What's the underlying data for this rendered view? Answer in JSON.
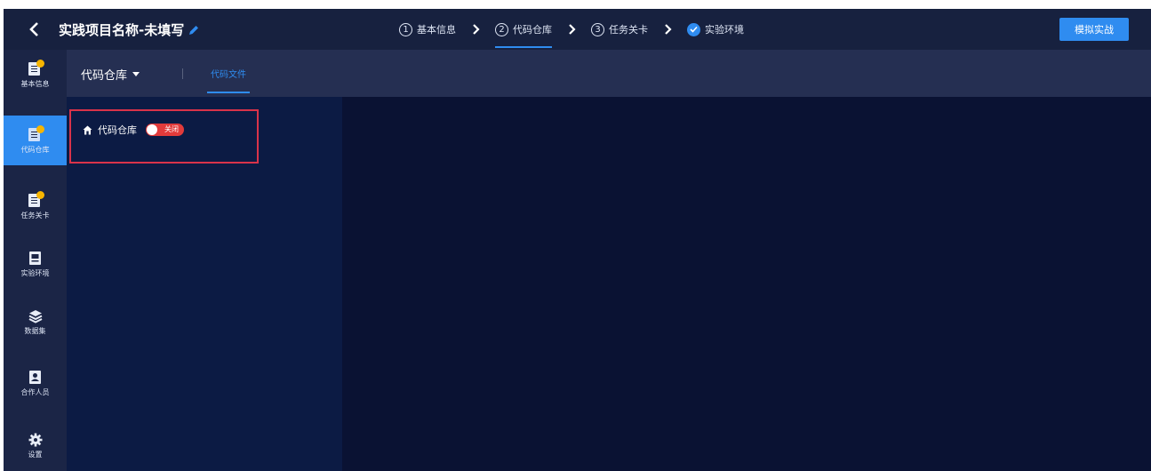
{
  "colors": {
    "accent": "#2f8cf0",
    "background": "#0a1233",
    "highlight_border": "#d9334a",
    "toggle_off": "#e23b3b",
    "badge": "#f7b500"
  },
  "header": {
    "back_icon": "chevron-left-icon",
    "project_title": "实践项目名称-未填写",
    "edit_icon": "pencil-icon",
    "steps": [
      {
        "num": "1",
        "label": "基本信息"
      },
      {
        "num": "2",
        "label": "代码仓库",
        "active": true
      },
      {
        "num": "3",
        "label": "任务关卡"
      },
      {
        "icon": "check-circle-icon",
        "label": "实验环境"
      }
    ],
    "primary_button": "模拟实战"
  },
  "sidebar": {
    "items": [
      {
        "label": "基本信息",
        "icon": "document-icon"
      },
      {
        "label": "代码仓库",
        "icon": "document-icon",
        "active": true
      },
      {
        "label": "任务关卡",
        "icon": "document-icon"
      },
      {
        "label": "实验环境",
        "icon": "monitor-icon"
      },
      {
        "label": "数据集",
        "icon": "database-icon"
      },
      {
        "label": "合作人员",
        "icon": "user-file-icon"
      },
      {
        "label": "设置",
        "icon": "gear-icon"
      }
    ]
  },
  "subheader": {
    "repo_select": "代码仓库",
    "tab": "代码文件"
  },
  "repo_panel": {
    "repo_name": "代码仓库",
    "toggle_state": "关闭"
  }
}
